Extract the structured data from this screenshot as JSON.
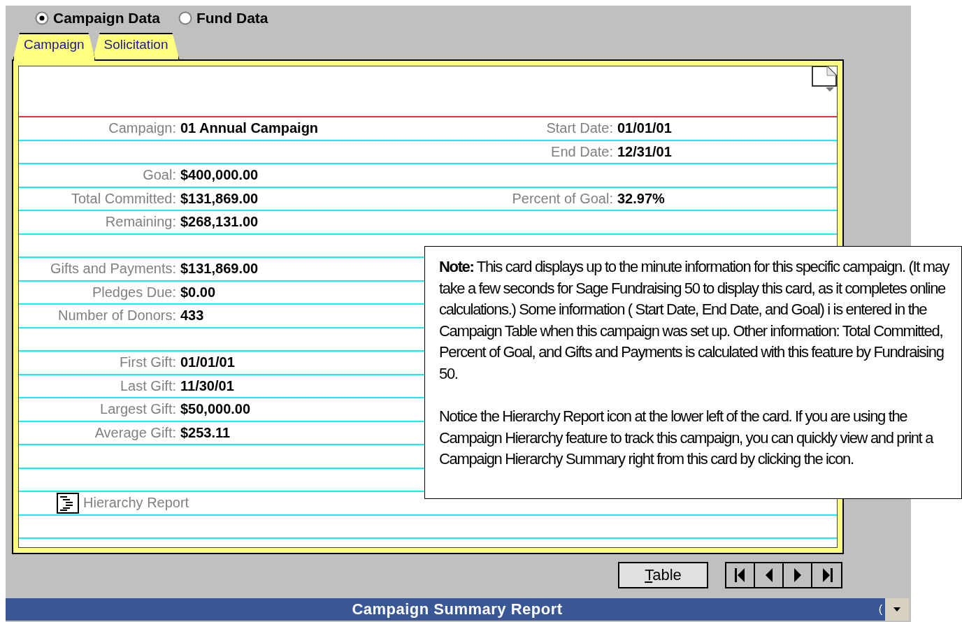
{
  "view_options": [
    {
      "label": "Campaign Data",
      "selected": true
    },
    {
      "label": "Fund Data",
      "selected": false
    }
  ],
  "tabs": [
    {
      "label": "Campaign",
      "selected": true
    },
    {
      "label": "Solicitation",
      "selected": false
    }
  ],
  "card": {
    "sections": [
      [
        {
          "left": {
            "label": "Campaign:",
            "value": "01 Annual Campaign"
          },
          "right": {
            "label": "Start Date:",
            "value": "01/01/01"
          }
        },
        {
          "right": {
            "label": "End Date:",
            "value": "12/31/01"
          }
        },
        {
          "left": {
            "label": "Goal:",
            "value": "$400,000.00"
          }
        },
        {
          "left": {
            "label": "Total Committed:",
            "value": "$131,869.00"
          },
          "right": {
            "label": "Percent of Goal:",
            "value": "32.97%"
          }
        },
        {
          "left": {
            "label": "Remaining:",
            "value": "$268,131.00"
          }
        }
      ],
      [
        {
          "left": {
            "label": "Gifts and Payments:",
            "value": "$131,869.00"
          }
        },
        {
          "left": {
            "label": "Pledges Due:",
            "value": "$0.00"
          }
        },
        {
          "left": {
            "label": "Number of Donors:",
            "value": "433"
          }
        }
      ],
      [
        {
          "left": {
            "label": "First Gift:",
            "value": "01/01/01"
          }
        },
        {
          "left": {
            "label": "Last Gift:",
            "value": "11/30/01"
          }
        },
        {
          "left": {
            "label": "Largest Gift:",
            "value": "$50,000.00"
          }
        },
        {
          "left": {
            "label": "Average Gift:",
            "value": "$253.11"
          }
        }
      ]
    ],
    "report_link": "Hierarchy Report"
  },
  "buttons": {
    "table": "Table"
  },
  "status_bar": {
    "title": "Campaign Summary Report",
    "fragment": "("
  },
  "note": {
    "paragraphs": [
      "**Note:** This card displays up to the minute information for this specific campaign. (It may take a few seconds for Sage Fundraising 50 to display this card, as it completes online calculations.) Some information ( Start Date, End Date, and Goal) i is entered in the Campaign Table when this campaign was set up. Other information: Total Committed, Percent of Goal, and Gifts and Payments is calculated with this feature by Fundraising 50.",
      "Notice the Hierarchy Report icon at the lower left of the card. If you are using the Campaign Hierarchy feature to track this campaign, you can quickly view and print a Campaign Hierarchy Summary right from this card by clicking the icon."
    ]
  }
}
